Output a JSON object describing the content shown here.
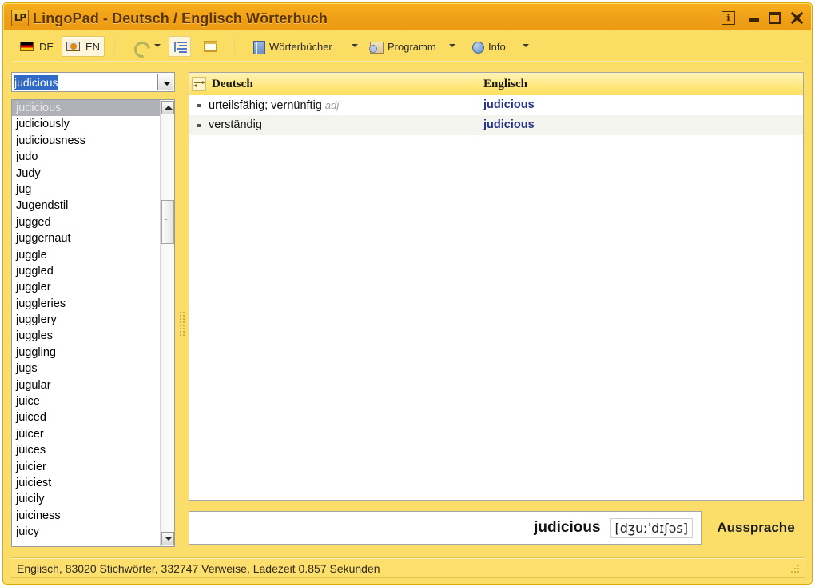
{
  "window": {
    "title": "LingoPad - Deutsch / Englisch Wörterbuch",
    "logo": "LP",
    "buttons": {
      "info": "i",
      "minimize": "minimize-button",
      "maximize": "maximize-button",
      "close": "close-button"
    },
    "accent_title_bg": "#f0a017",
    "accent_body_bg": "#fbdd6a"
  },
  "toolbar": {
    "lang_de": "DE",
    "lang_en": "EN",
    "lang_active": "EN",
    "refresh_icon": "refresh-icon",
    "list_icon": "list-view-icon",
    "window_icon": "window-icon",
    "menus": [
      {
        "label": "Wörterbücher",
        "icon": "book-icon"
      },
      {
        "label": "Programm",
        "icon": "program-icon"
      },
      {
        "label": "Info",
        "icon": "info-globe-icon"
      }
    ]
  },
  "search": {
    "value": "judicious",
    "placeholder": "",
    "dropdown_icon": "chevron-down-icon"
  },
  "wordlist": {
    "selected": "judicious",
    "items": [
      "judicious",
      "judiciously",
      "judiciousness",
      "judo",
      "Judy",
      "jug",
      "Jugendstil",
      "jugged",
      "juggernaut",
      "juggle",
      "juggled",
      "juggler",
      "juggleries",
      "jugglery",
      "juggles",
      "juggling",
      "jugs",
      "jugular",
      "juice",
      "juiced",
      "juicer",
      "juices",
      "juicier",
      "juiciest",
      "juicily",
      "juiciness",
      "juicy"
    ]
  },
  "results": {
    "swap_icon": "swap-columns-icon",
    "columns": [
      "Deutsch",
      "Englisch"
    ],
    "rows": [
      {
        "de": "urteilsfähig; vernünftig",
        "de_pos": "adj",
        "en": "judicious"
      },
      {
        "de": "verständig",
        "de_pos": "",
        "en": "judicious"
      }
    ]
  },
  "pronunciation": {
    "word": "judicious",
    "ipa": "[dʒuːˈdɪʃəs]",
    "button_label": "Aussprache"
  },
  "statusbar": {
    "text": "Englisch, 83020 Stichwörter, 332747 Verweise, Ladezeit 0.857 Sekunden"
  }
}
